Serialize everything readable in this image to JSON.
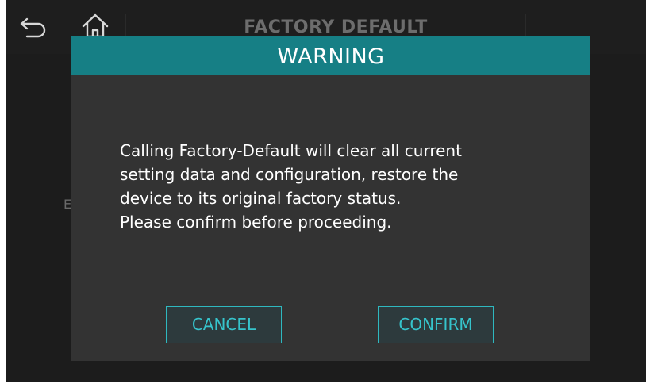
{
  "header": {
    "title": "FACTORY DEFAULT",
    "back_icon": "back-arrow-icon",
    "home_icon": "home-icon"
  },
  "background": {
    "partial_text": "E"
  },
  "dialog": {
    "title": "WARNING",
    "message_lines": [
      "Calling Factory-Default will clear all current",
      "setting data and configuration, restore the",
      "device to its original factory status.",
      "Please confirm before proceeding."
    ],
    "cancel_label": "CANCEL",
    "confirm_label": "CONFIRM"
  },
  "colors": {
    "header_accent": "#167f85",
    "button_accent": "#36c4cc",
    "dialog_bg": "#333333",
    "screen_bg": "#1c1c1c"
  }
}
